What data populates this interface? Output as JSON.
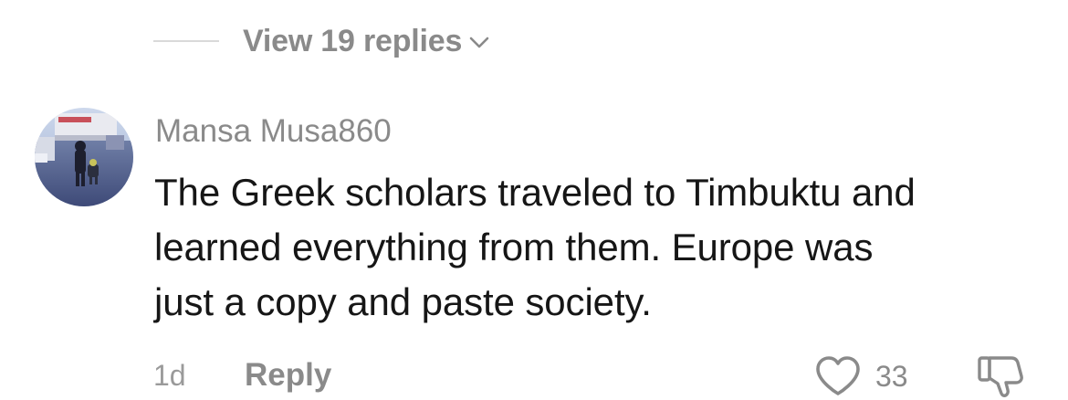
{
  "replies": {
    "label": "View 19 replies"
  },
  "comment": {
    "username": "Mansa Musa860",
    "text_lines": [
      "The Greek scholars traveled to Timbuktu and",
      "learned everything from them. Europe was",
      "just a copy and paste society."
    ],
    "time": "1d",
    "reply_label": "Reply",
    "like_count": "33"
  },
  "icons": {
    "expand": "chevron-down-icon",
    "like": "heart-outline-icon",
    "dislike": "thumbs-down-icon"
  },
  "colors": {
    "secondary_text": "#8a8a8a",
    "primary_text": "#161616",
    "divider": "#d9d9d9",
    "background": "#ffffff"
  }
}
